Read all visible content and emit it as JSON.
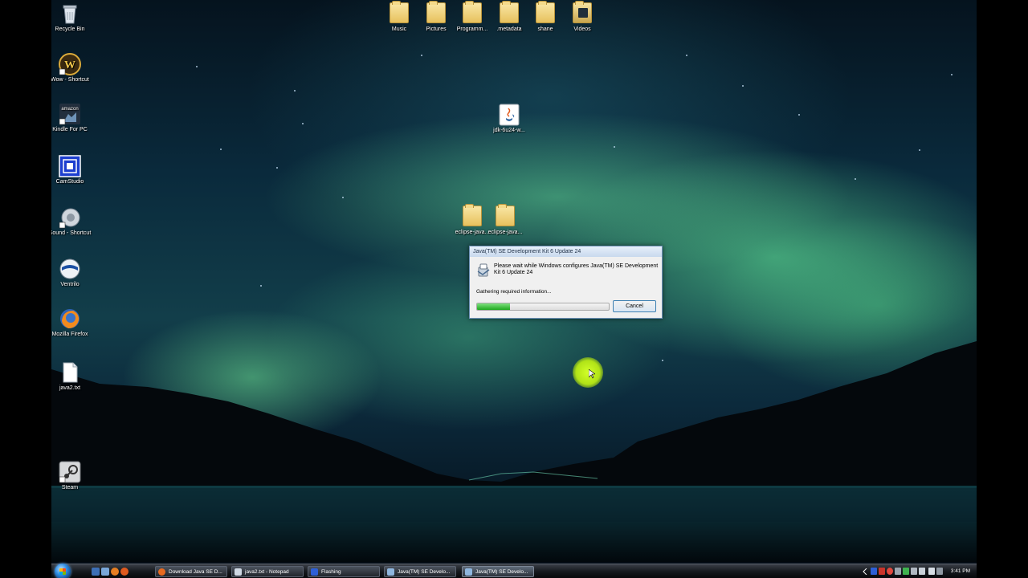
{
  "desktop": {
    "left_icons": [
      {
        "label": "Recycle Bin"
      },
      {
        "label": "Wow - Shortcut"
      },
      {
        "label": "Kindle For PC"
      },
      {
        "label": "CamStudio"
      },
      {
        "label": "Sound - Shortcut"
      },
      {
        "label": "Ventrilo"
      },
      {
        "label": "Mozilla Firefox"
      },
      {
        "label": "java2.txt"
      },
      {
        "label": "Steam"
      }
    ],
    "top_icons": [
      {
        "label": "Music"
      },
      {
        "label": "Pictures"
      },
      {
        "label": "Programm..."
      },
      {
        "label": ".metadata"
      },
      {
        "label": "shane"
      },
      {
        "label": "Videos"
      }
    ],
    "mid_icons": [
      {
        "label": "jdk-6u24-w..."
      },
      {
        "label": "eclipse-java..."
      },
      {
        "label": "eclipse-java..."
      }
    ]
  },
  "installer_dialog": {
    "title": "Java(TM) SE Development Kit 6 Update 24",
    "message": "Please wait while Windows configures Java(TM) SE Development Kit 6 Update 24",
    "status": "Gathering required information...",
    "progress": 0.25,
    "cancel_label": "Cancel"
  },
  "taskbar": {
    "buttons": [
      {
        "label": "Download Java SE D...",
        "icon_color": "#e86a1f"
      },
      {
        "label": "java2.txt - Notepad",
        "icon_color": "#cfd8e3"
      },
      {
        "label": "Flashing",
        "icon_color": "#2d5fd6"
      },
      {
        "label": "Java(TM) SE Develo...",
        "icon_color": "#8fb6de"
      },
      {
        "label": "Java(TM) SE Develo...",
        "icon_color": "#8fb6de"
      }
    ],
    "clock": "3:41 PM"
  }
}
